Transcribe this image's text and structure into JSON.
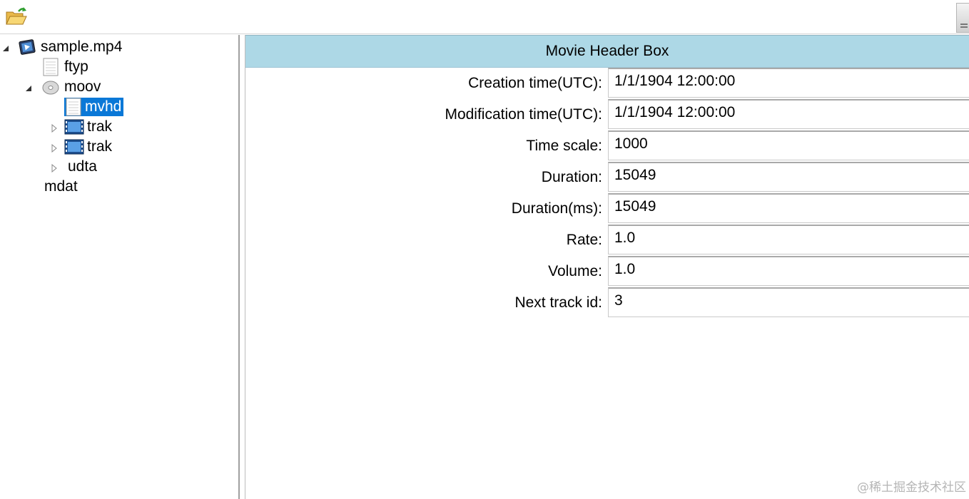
{
  "toolbar": {
    "open_icon": "open-folder-icon"
  },
  "tree": {
    "root": {
      "label": "sample.mp4",
      "icon": "movie-file-icon",
      "expanded": true
    },
    "items": [
      {
        "label": "ftyp",
        "icon": "document-icon"
      },
      {
        "label": "moov",
        "icon": "disc-icon",
        "expanded": true
      },
      {
        "label": "mvhd",
        "icon": "document-icon",
        "selected": true
      },
      {
        "label": "trak",
        "icon": "film-icon",
        "expanded": false
      },
      {
        "label": "trak",
        "icon": "film-icon",
        "expanded": false
      },
      {
        "label": "udta",
        "expanded": false
      },
      {
        "label": "mdat"
      }
    ]
  },
  "detail": {
    "title": "Movie Header Box",
    "fields": [
      {
        "label": "Creation time(UTC):",
        "value": "1/1/1904 12:00:00"
      },
      {
        "label": "Modification time(UTC):",
        "value": "1/1/1904 12:00:00"
      },
      {
        "label": "Time scale:",
        "value": "1000"
      },
      {
        "label": "Duration:",
        "value": "15049"
      },
      {
        "label": "Duration(ms):",
        "value": "15049"
      },
      {
        "label": "Rate:",
        "value": "1.0"
      },
      {
        "label": "Volume:",
        "value": "1.0"
      },
      {
        "label": "Next track id:",
        "value": "3"
      }
    ]
  },
  "watermark": "@稀土掘金技术社区",
  "colors": {
    "header_bg": "#add8e6",
    "selection_bg": "#0a78d7"
  }
}
